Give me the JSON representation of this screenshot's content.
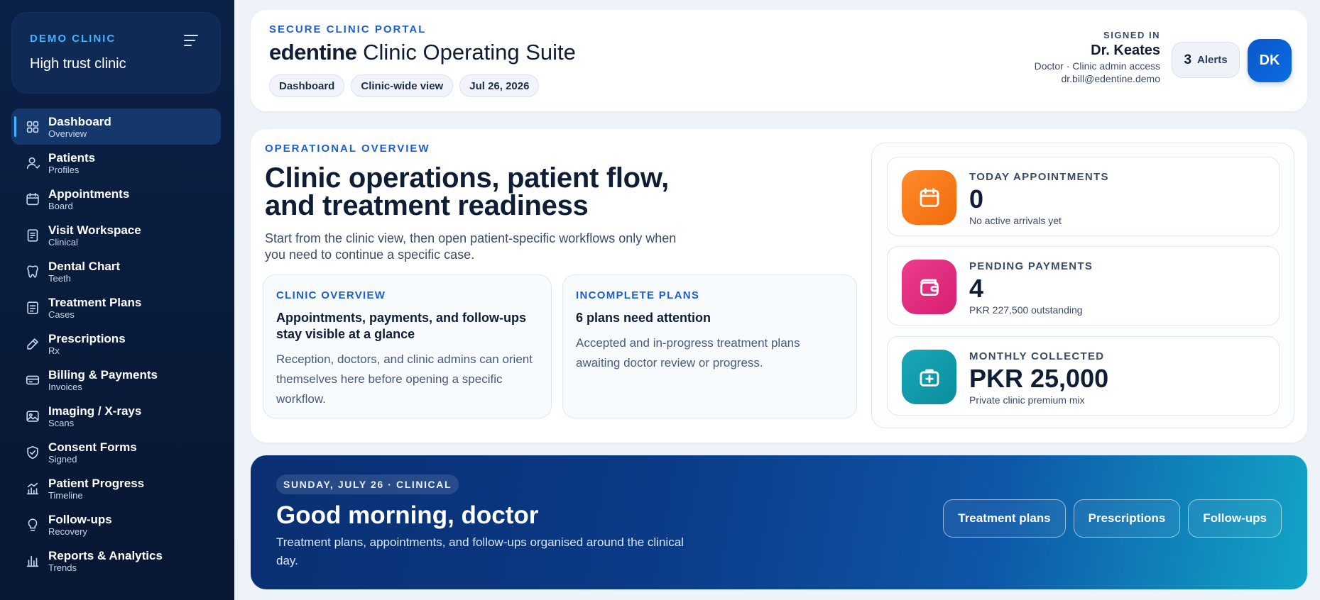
{
  "sidebar": {
    "brand_eyebrow": "DEMO CLINIC",
    "brand_name": "High trust clinic",
    "menu_icon": "menu-icon",
    "items": [
      {
        "label": "Dashboard",
        "sub": "Overview",
        "icon": "grid-icon",
        "active": true
      },
      {
        "label": "Patients",
        "sub": "Profiles",
        "icon": "user-icon"
      },
      {
        "label": "Appointments",
        "sub": "Board",
        "icon": "calendar-icon"
      },
      {
        "label": "Visit Workspace",
        "sub": "Clinical",
        "icon": "clipboard-icon"
      },
      {
        "label": "Dental Chart",
        "sub": "Teeth",
        "icon": "tooth-icon"
      },
      {
        "label": "Treatment Plans",
        "sub": "Cases",
        "icon": "document-icon"
      },
      {
        "label": "Prescriptions",
        "sub": "Rx",
        "icon": "pen-icon"
      },
      {
        "label": "Billing & Payments",
        "sub": "Invoices",
        "icon": "credit-card-icon"
      },
      {
        "label": "Imaging / X-rays",
        "sub": "Scans",
        "icon": "image-icon"
      },
      {
        "label": "Consent Forms",
        "sub": "Signed",
        "icon": "shield-check-icon"
      },
      {
        "label": "Patient Progress",
        "sub": "Timeline",
        "icon": "progress-chart-icon"
      },
      {
        "label": "Follow-ups",
        "sub": "Recovery",
        "icon": "lightbulb-icon"
      },
      {
        "label": "Reports & Analytics",
        "sub": "Trends",
        "icon": "bar-chart-icon"
      }
    ]
  },
  "header": {
    "eyebrow": "SECURE CLINIC PORTAL",
    "title_brand": "edentine",
    "title_rest": "Clinic Operating Suite",
    "chips": [
      "Dashboard",
      "Clinic-wide view",
      "Jul 26, 2026"
    ],
    "signed_in_label": "SIGNED IN",
    "user_name": "Dr. Keates",
    "user_role": "Doctor · Clinic admin access",
    "user_email": "dr.bill@edentine.demo",
    "alerts_count": "3",
    "alerts_label": "Alerts",
    "avatar_initials": "DK"
  },
  "overview": {
    "eyebrow": "OPERATIONAL OVERVIEW",
    "title_line1": "Clinic operations, patient flow,",
    "title_line2": "and treatment readiness",
    "description": "Start from the clinic view, then open patient-specific workflows only when you need to continue a specific case.",
    "boxes": [
      {
        "eyebrow": "CLINIC OVERVIEW",
        "title": "Appointments, payments, and follow-ups stay visible at a glance",
        "body": "Reception, doctors, and clinic admins can orient themselves here before opening a specific workflow."
      },
      {
        "eyebrow": "INCOMPLETE PLANS",
        "title": "6 plans need attention",
        "body": "Accepted and in-progress treatment plans awaiting doctor review or progress."
      }
    ],
    "stats": [
      {
        "label": "TODAY APPOINTMENTS",
        "value": "0",
        "note": "No active arrivals yet",
        "icon": "calendar-icon",
        "color": "#f5761a"
      },
      {
        "label": "PENDING PAYMENTS",
        "value": "4",
        "note": "PKR 227,500 outstanding",
        "icon": "wallet-icon",
        "color": "#e02d7f"
      },
      {
        "label": "MONTHLY COLLECTED",
        "value": "PKR 25,000",
        "note": "Private clinic premium mix",
        "icon": "medical-kit-icon",
        "color": "#12a0b0"
      }
    ]
  },
  "banner": {
    "pill": "SUNDAY, JULY 26 · CLINICAL",
    "title": "Good morning, doctor",
    "subtitle": "Treatment plans, appointments, and follow-ups organised around the clinical day.",
    "buttons": [
      "Treatment plans",
      "Prescriptions",
      "Follow-ups"
    ]
  },
  "colors": {
    "accent": "#1b5fd0",
    "sidebar_bg": "#0a2147",
    "sidebar_accent": "#3fb5ff",
    "page_bg": "#eef3f9"
  }
}
